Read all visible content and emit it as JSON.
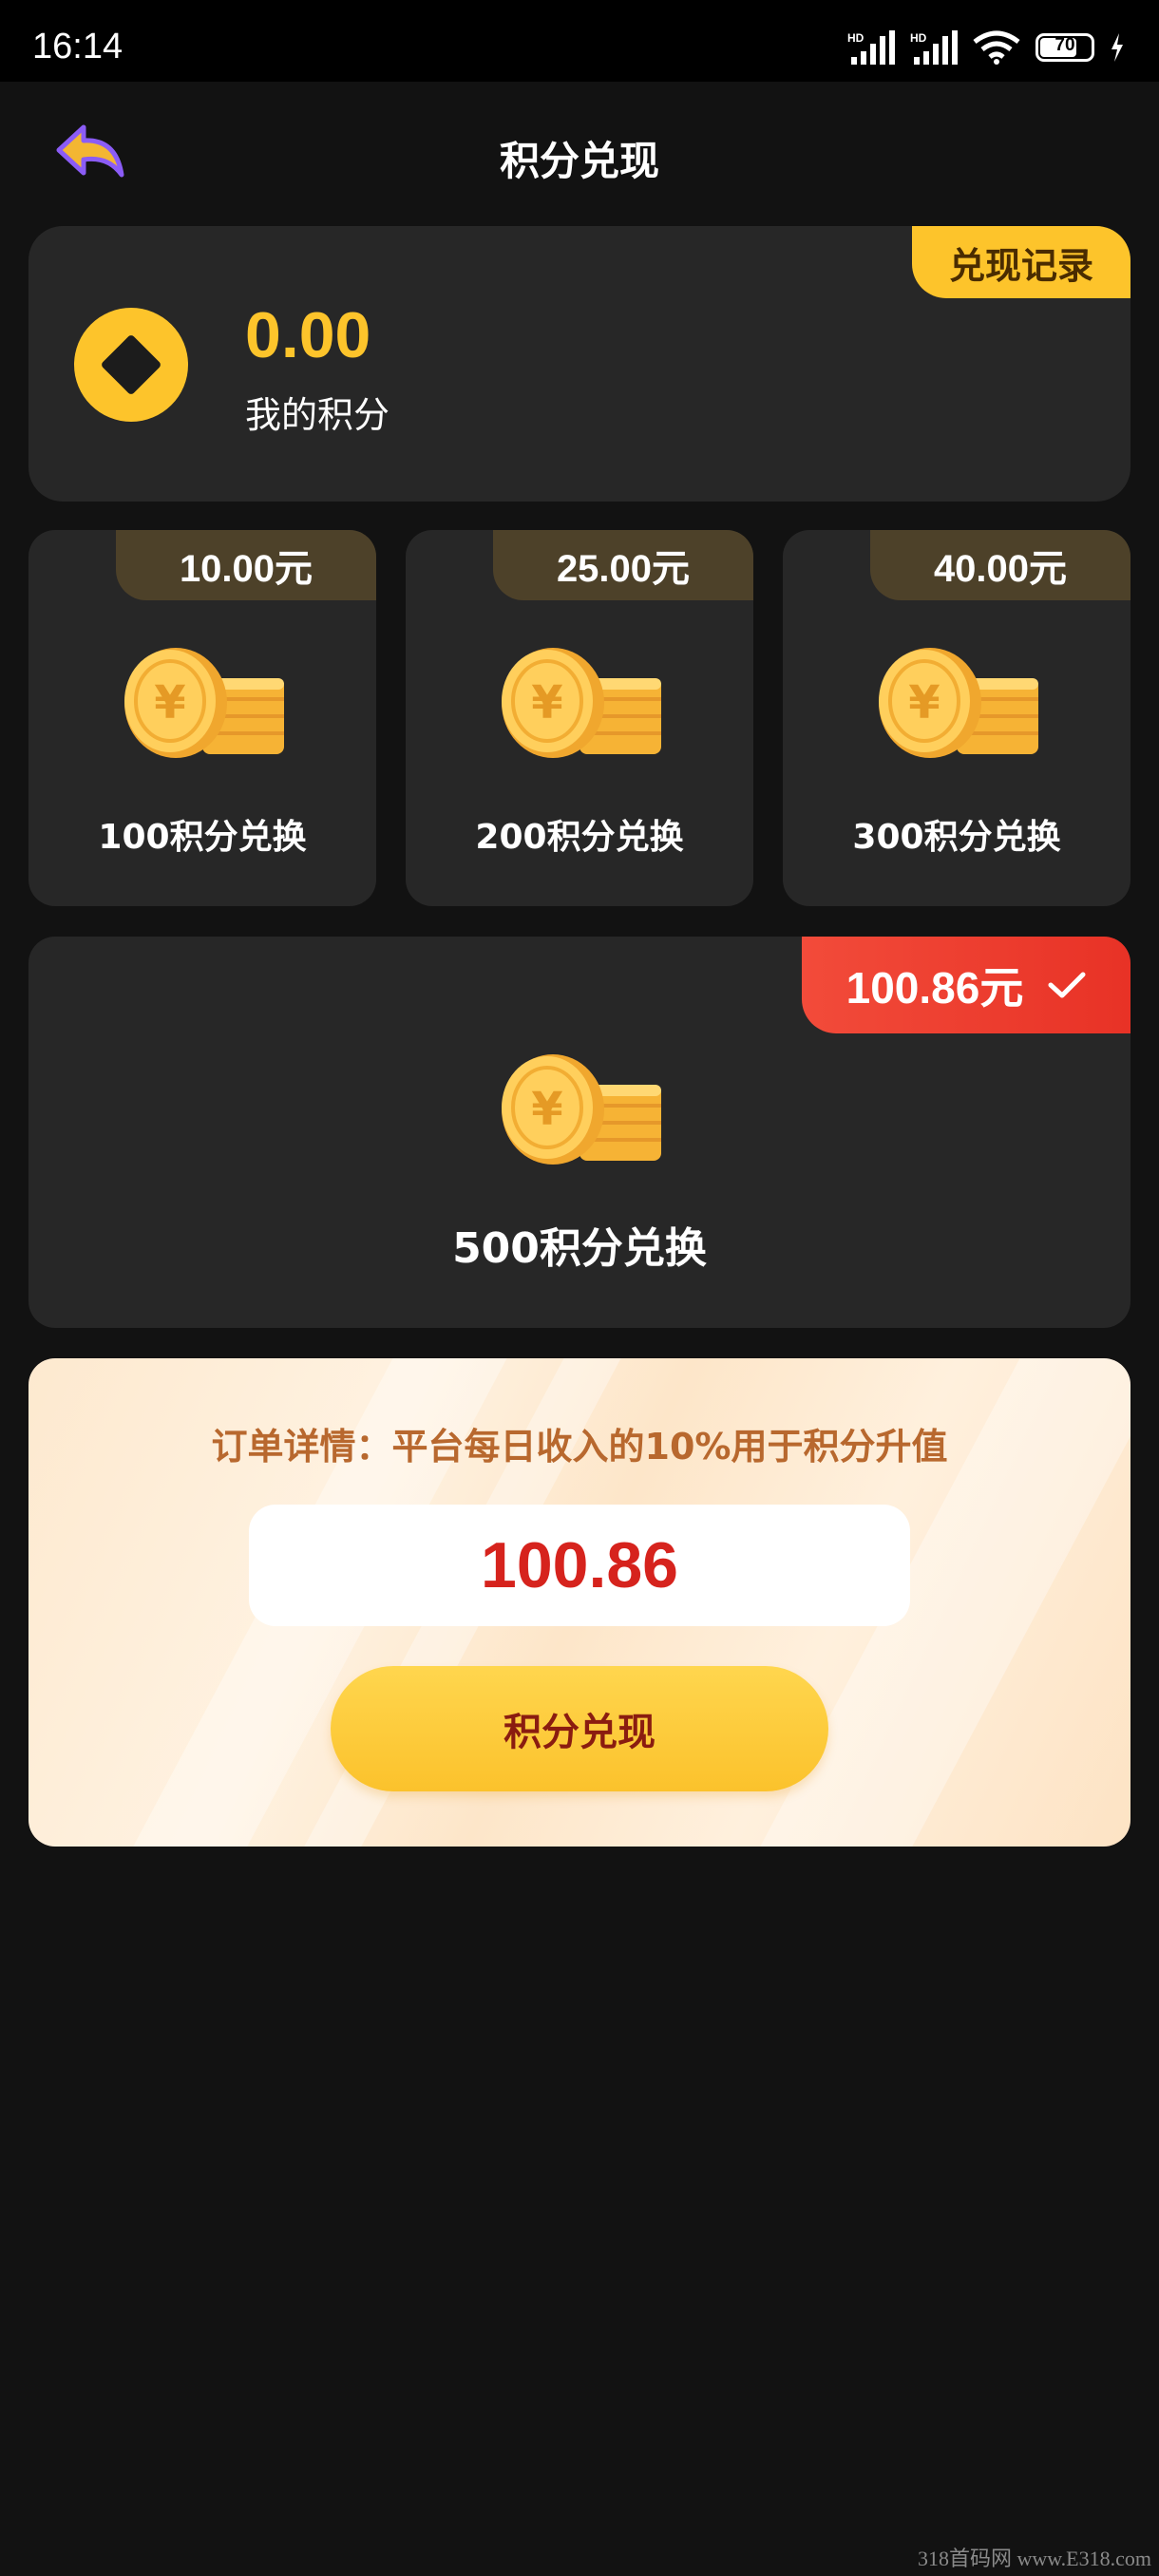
{
  "status_bar": {
    "time": "16:14",
    "battery": "70",
    "signal_label": "HD"
  },
  "nav": {
    "title": "积分兑现"
  },
  "points": {
    "value": "0.00",
    "label": "我的积分",
    "record_tag": "兑现记录"
  },
  "options": [
    {
      "amount": "10.00元",
      "label": "100积分兑换"
    },
    {
      "amount": "25.00元",
      "label": "200积分兑换"
    },
    {
      "amount": "40.00元",
      "label": "300积分兑换"
    }
  ],
  "selected_option": {
    "amount": "100.86元",
    "label": "500积分兑换",
    "selected": true
  },
  "order": {
    "detail": "订单详情：平台每日收入的10%用于积分升值",
    "amount": "100.86",
    "button": "积分兑现"
  },
  "watermark": "318首码网 www.E318.com",
  "colors": {
    "background": "#121212",
    "card": "#272727",
    "accent": "#fdc42b",
    "red": "#e83226"
  },
  "icons": {
    "back": "back-arrow-icon",
    "points": "diamond-coin-icon",
    "coin": "coin-stack-icon",
    "check": "check-icon"
  }
}
